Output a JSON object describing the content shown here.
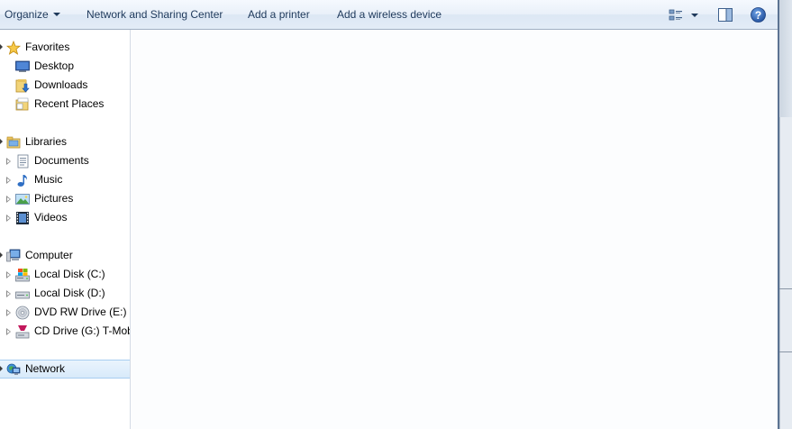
{
  "toolbar": {
    "organize": "Organize",
    "network_sharing_center": "Network and Sharing Center",
    "add_printer": "Add a printer",
    "add_wireless": "Add a wireless device",
    "views_icon": "views-icon",
    "preview_pane_icon": "preview-pane-icon",
    "help_icon": "help-icon"
  },
  "nav": {
    "favorites": {
      "label": "Favorites",
      "items": [
        {
          "label": "Desktop"
        },
        {
          "label": "Downloads"
        },
        {
          "label": "Recent Places"
        }
      ]
    },
    "libraries": {
      "label": "Libraries",
      "items": [
        {
          "label": "Documents"
        },
        {
          "label": "Music"
        },
        {
          "label": "Pictures"
        },
        {
          "label": "Videos"
        }
      ]
    },
    "computer": {
      "label": "Computer",
      "items": [
        {
          "label": "Local Disk (C:)"
        },
        {
          "label": "Local Disk (D:)"
        },
        {
          "label": "DVD RW Drive (E:) M"
        },
        {
          "label": "CD Drive (G:) T-Mob"
        }
      ]
    },
    "network": {
      "label": "Network",
      "selected": true
    }
  },
  "colors": {
    "toolbar_text": "#1e395b",
    "selection": "#d8eafa",
    "selection_border": "#a7cdf0",
    "content_bg": "#fcfdfe"
  }
}
